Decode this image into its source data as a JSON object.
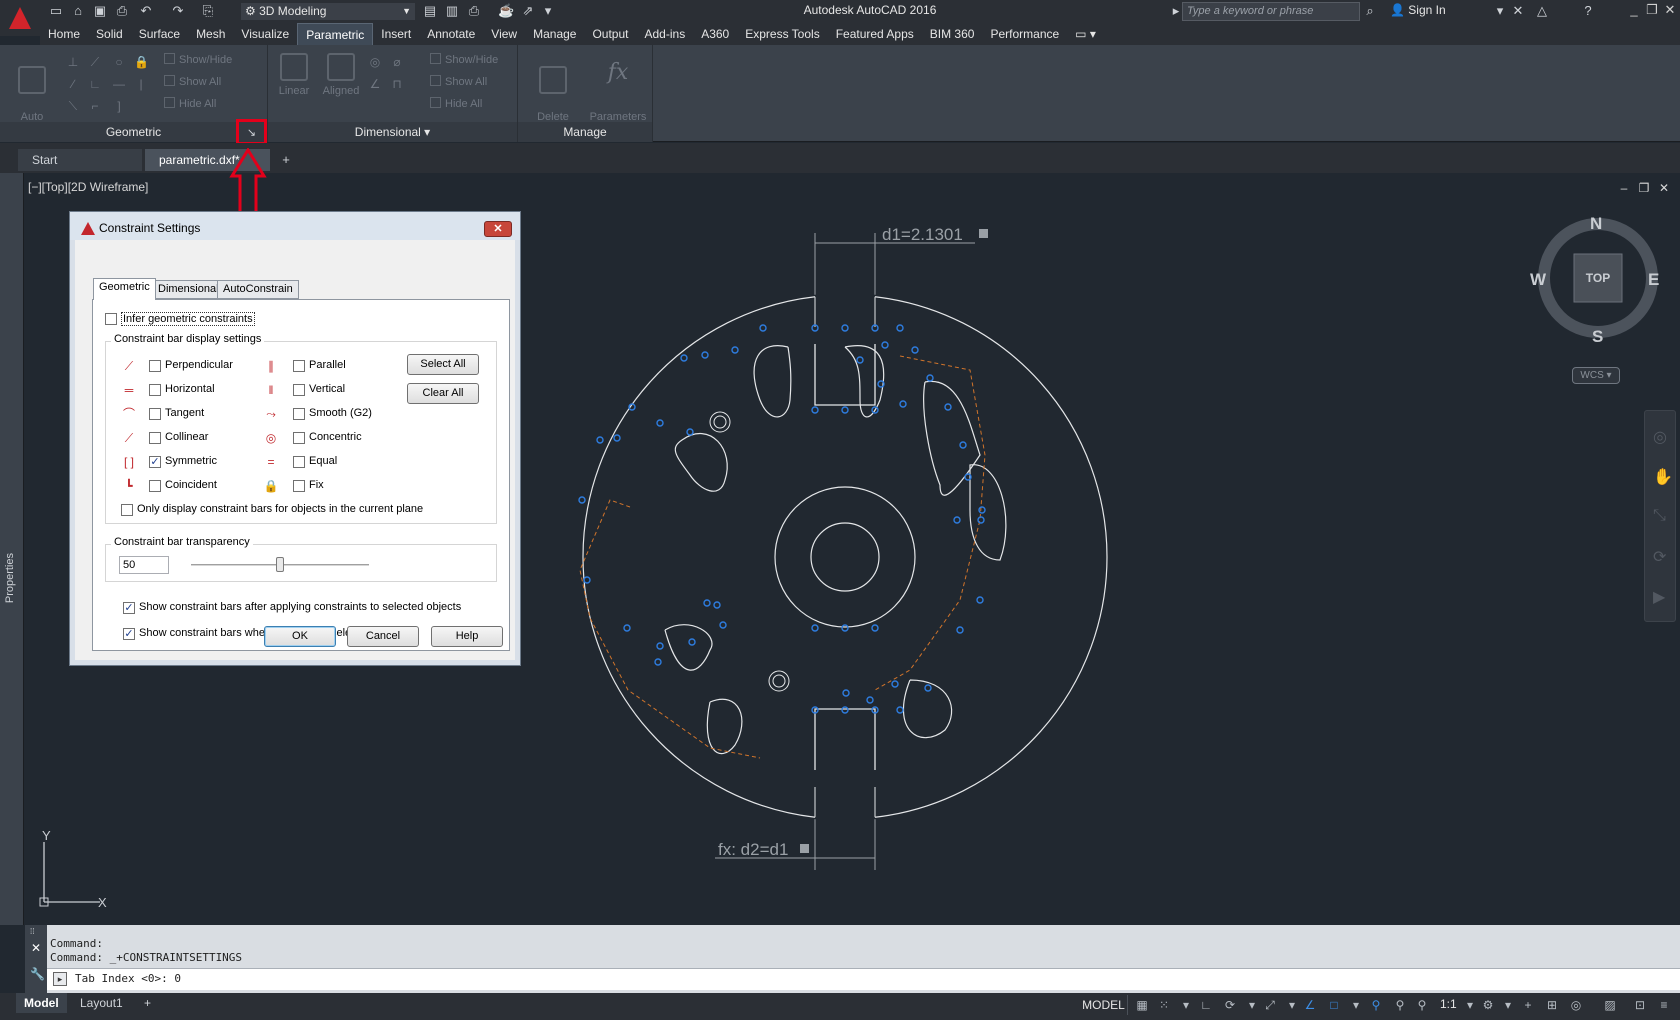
{
  "app": {
    "title": "Autodesk AutoCAD 2016",
    "workspace": "3D Modeling",
    "search_placeholder": "Type a keyword or phrase",
    "sign_in": "Sign In"
  },
  "ribbon": {
    "tabs": [
      "Home",
      "Solid",
      "Surface",
      "Mesh",
      "Visualize",
      "Parametric",
      "Insert",
      "Annotate",
      "View",
      "Manage",
      "Output",
      "Add-ins",
      "A360",
      "Express Tools",
      "Featured Apps",
      "BIM 360",
      "Performance"
    ],
    "active_tab": "Parametric",
    "panels": {
      "geometric": {
        "title": "Geometric",
        "auto_constrain": "Auto\nConstrain",
        "show_hide": "Show/Hide",
        "show_all": "Show All",
        "hide_all": "Hide All"
      },
      "dimensional": {
        "title": "Dimensional",
        "linear": "Linear",
        "aligned": "Aligned",
        "show_hide": "Show/Hide",
        "show_all": "Show All",
        "hide_all": "Hide All"
      },
      "manage": {
        "title": "Manage",
        "delete_constraints": "Delete\nConstraints",
        "parameters_manager": "Parameters\nManager",
        "fx": "fx"
      }
    }
  },
  "file_tabs": [
    "Start",
    "parametric.dxf*"
  ],
  "active_file_tab": "parametric.dxf*",
  "side_panel_label": "Properties",
  "viewport": {
    "label": "[−][Top][2D Wireframe]",
    "viewcube": {
      "n": "N",
      "s": "S",
      "e": "E",
      "w": "W",
      "face": "TOP"
    },
    "wcs": "WCS",
    "dim1": "d1=2.1301",
    "dim2": "fx: d2=d1",
    "ucs_x": "X",
    "ucs_y": "Y"
  },
  "command": {
    "history": [
      "Command:",
      "Command: _+CONSTRAINTSETTINGS"
    ],
    "input": "Tab Index <0>: 0"
  },
  "status": {
    "layout_tabs": [
      "Model",
      "Layout1"
    ],
    "model_button": "MODEL",
    "scale": "1:1"
  },
  "dialog": {
    "title": "Constraint Settings",
    "tabs": [
      "Geometric",
      "Dimensional",
      "AutoConstrain"
    ],
    "active_tab": "Geometric",
    "infer_label": "Infer geometric constraints",
    "infer_checked": false,
    "display_group_title": "Constraint bar display settings",
    "constraints_left": [
      {
        "label": "Perpendicular",
        "checked": false,
        "icon": "perpendicular-icon"
      },
      {
        "label": "Horizontal",
        "checked": false,
        "icon": "horizontal-icon"
      },
      {
        "label": "Tangent",
        "checked": false,
        "icon": "tangent-icon"
      },
      {
        "label": "Collinear",
        "checked": false,
        "icon": "collinear-icon"
      },
      {
        "label": "Symmetric",
        "checked": true,
        "icon": "symmetric-icon"
      },
      {
        "label": "Coincident",
        "checked": false,
        "icon": "coincident-icon"
      }
    ],
    "constraints_right": [
      {
        "label": "Parallel",
        "checked": false,
        "icon": "parallel-icon"
      },
      {
        "label": "Vertical",
        "checked": false,
        "icon": "vertical-icon"
      },
      {
        "label": "Smooth (G2)",
        "checked": false,
        "icon": "smooth-icon"
      },
      {
        "label": "Concentric",
        "checked": false,
        "icon": "concentric-icon"
      },
      {
        "label": "Equal",
        "checked": false,
        "icon": "equal-icon"
      },
      {
        "label": "Fix",
        "checked": false,
        "icon": "lock-icon"
      }
    ],
    "select_all": "Select All",
    "clear_all": "Clear All",
    "only_plane_label": "Only display constraint bars for objects in the current plane",
    "only_plane_checked": false,
    "transparency_title": "Constraint bar transparency",
    "transparency_value": "50",
    "transparency_level": 50,
    "show_after_label": "Show constraint bars after applying constraints to selected objects",
    "show_after_checked": true,
    "show_selected_label": "Show constraint bars when objects are selected",
    "show_selected_checked": true,
    "ok": "OK",
    "cancel": "Cancel",
    "help": "Help"
  },
  "colors": {
    "accent_red": "#e3001b",
    "canvas": "#212830",
    "ribbon": "#3b424b",
    "constraint_blue": "#2e7de0"
  }
}
